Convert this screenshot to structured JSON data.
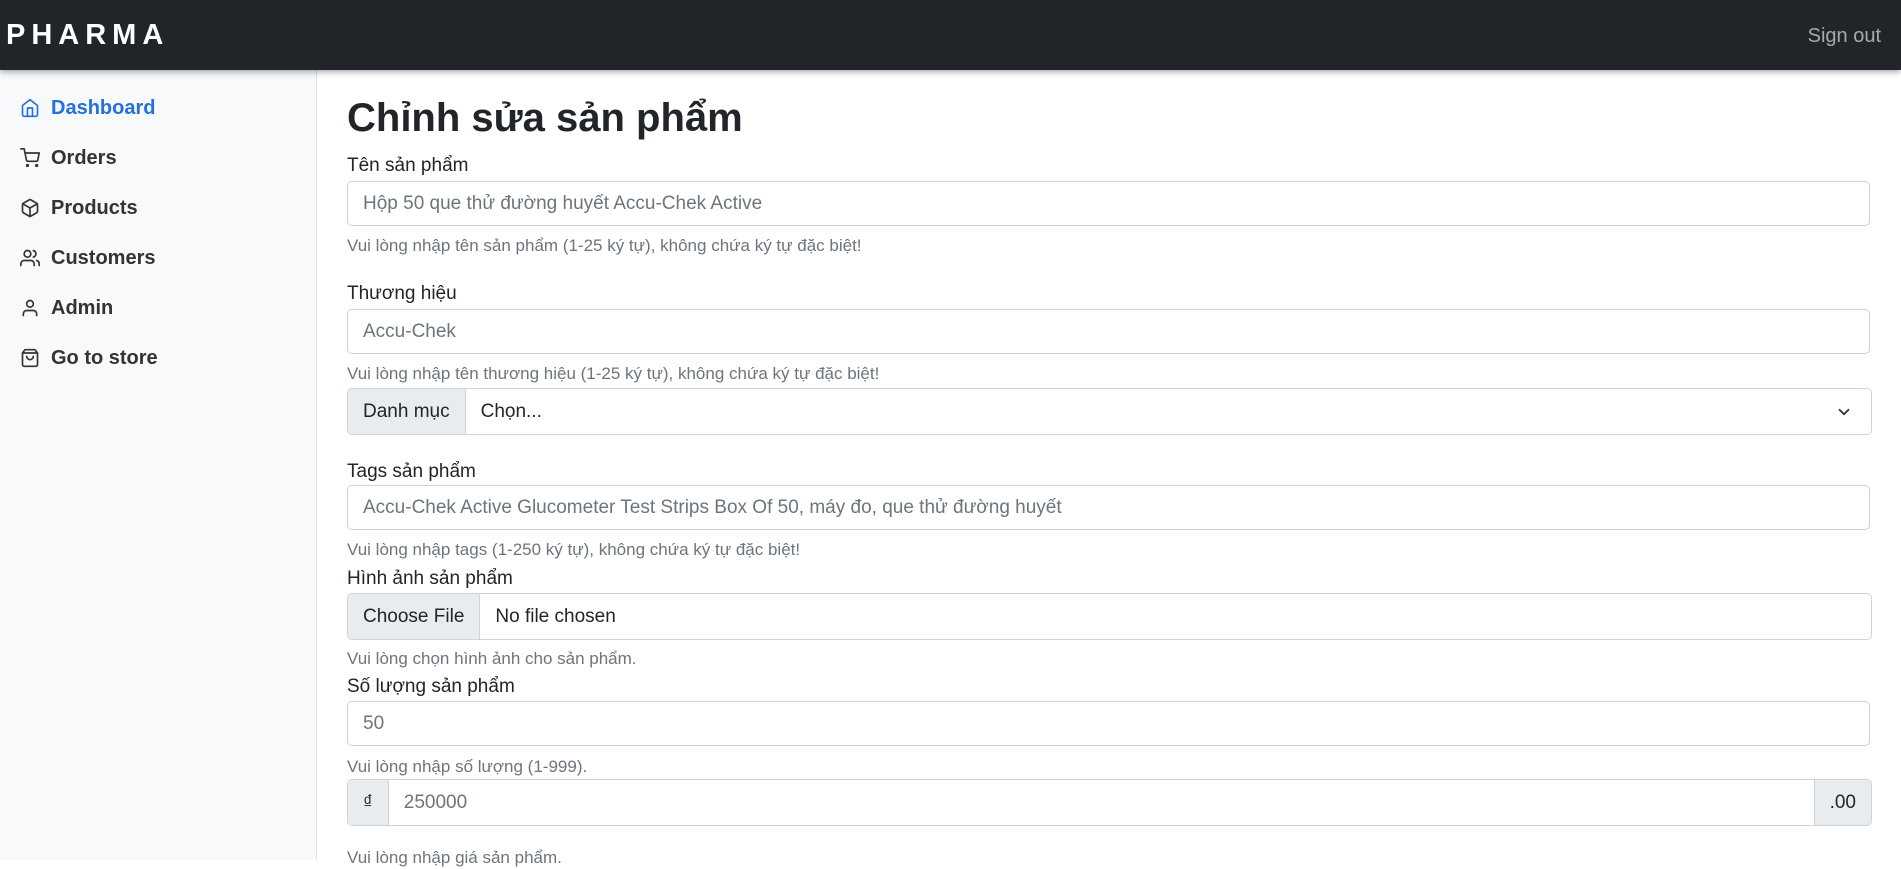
{
  "brand": "PHARMA",
  "header": {
    "signout_label": "Sign out"
  },
  "sidebar": {
    "items": [
      {
        "label": "Dashboard",
        "icon": "home-icon",
        "active": true
      },
      {
        "label": "Orders",
        "icon": "cart-icon"
      },
      {
        "label": "Products",
        "icon": "box-icon"
      },
      {
        "label": "Customers",
        "icon": "users-icon"
      },
      {
        "label": "Admin",
        "icon": "user-icon"
      },
      {
        "label": "Go to store",
        "icon": "shopping-bag-icon"
      }
    ]
  },
  "form": {
    "title": "Chỉnh sửa sản phẩm",
    "name": {
      "label": "Tên sản phẩm",
      "placeholder": "Hộp 50 que thử đường huyết Accu-Chek Active",
      "help": "Vui lòng nhập tên sản phẩm (1-25 ký tự), không chứa ký tự đặc biệt!"
    },
    "brand": {
      "label": "Thương hiệu",
      "placeholder": "Accu-Chek",
      "help": "Vui lòng nhập tên thương hiệu (1-25 ký tự), không chứa ký tự đặc biệt!"
    },
    "category": {
      "addon": "Danh mục",
      "selected": "Chọn..."
    },
    "tags": {
      "label": "Tags sản phẩm",
      "placeholder": "Accu-Chek Active Glucometer Test Strips Box Of 50, máy đo, que thử đường huyết",
      "help": "Vui lòng nhập tags (1-250 ký tự), không chứa ký tự đặc biệt!"
    },
    "image": {
      "label": "Hình ảnh sản phẩm",
      "button": "Choose File",
      "status": "No file chosen",
      "help": "Vui lòng chọn hình ảnh cho sản phẩm."
    },
    "quantity": {
      "label": "Số lượng sản phẩm",
      "placeholder": "50",
      "help": "Vui lòng nhập số lượng (1-999)."
    },
    "price": {
      "prefix": "₫",
      "placeholder": "250000",
      "suffix": ".00",
      "help": "Vui lòng nhập giá sản phẩm."
    }
  },
  "colors": {
    "navbar": "#212529",
    "accent": "#2470dc",
    "sidebar": "#f8f9fa"
  }
}
